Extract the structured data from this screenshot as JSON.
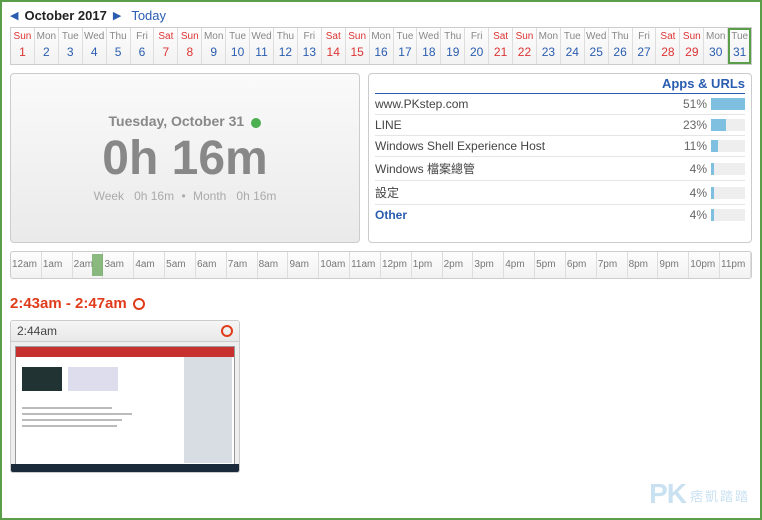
{
  "nav": {
    "prev_glyph": "◀",
    "next_glyph": "▶",
    "month_label": "October 2017",
    "today_label": "Today"
  },
  "calendar": {
    "selected_index": 30,
    "cells": [
      {
        "dow": "Sun",
        "n": "1",
        "wk": true
      },
      {
        "dow": "Mon",
        "n": "2",
        "wk": false
      },
      {
        "dow": "Tue",
        "n": "3",
        "wk": false
      },
      {
        "dow": "Wed",
        "n": "4",
        "wk": false
      },
      {
        "dow": "Thu",
        "n": "5",
        "wk": false
      },
      {
        "dow": "Fri",
        "n": "6",
        "wk": false
      },
      {
        "dow": "Sat",
        "n": "7",
        "wk": true
      },
      {
        "dow": "Sun",
        "n": "8",
        "wk": true
      },
      {
        "dow": "Mon",
        "n": "9",
        "wk": false
      },
      {
        "dow": "Tue",
        "n": "10",
        "wk": false
      },
      {
        "dow": "Wed",
        "n": "11",
        "wk": false
      },
      {
        "dow": "Thu",
        "n": "12",
        "wk": false
      },
      {
        "dow": "Fri",
        "n": "13",
        "wk": false
      },
      {
        "dow": "Sat",
        "n": "14",
        "wk": true
      },
      {
        "dow": "Sun",
        "n": "15",
        "wk": true
      },
      {
        "dow": "Mon",
        "n": "16",
        "wk": false
      },
      {
        "dow": "Tue",
        "n": "17",
        "wk": false
      },
      {
        "dow": "Wed",
        "n": "18",
        "wk": false
      },
      {
        "dow": "Thu",
        "n": "19",
        "wk": false
      },
      {
        "dow": "Fri",
        "n": "20",
        "wk": false
      },
      {
        "dow": "Sat",
        "n": "21",
        "wk": true
      },
      {
        "dow": "Sun",
        "n": "22",
        "wk": true
      },
      {
        "dow": "Mon",
        "n": "23",
        "wk": false
      },
      {
        "dow": "Tue",
        "n": "24",
        "wk": false
      },
      {
        "dow": "Wed",
        "n": "25",
        "wk": false
      },
      {
        "dow": "Thu",
        "n": "26",
        "wk": false
      },
      {
        "dow": "Fri",
        "n": "27",
        "wk": false
      },
      {
        "dow": "Sat",
        "n": "28",
        "wk": true
      },
      {
        "dow": "Sun",
        "n": "29",
        "wk": true
      },
      {
        "dow": "Mon",
        "n": "30",
        "wk": false
      },
      {
        "dow": "Tue",
        "n": "31",
        "wk": false
      }
    ]
  },
  "summary": {
    "date_label": "Tuesday, October 31",
    "big_time": "0h 16m",
    "week_label": "Week",
    "week_time": "0h 16m",
    "month_label": "Month",
    "month_time": "0h 16m"
  },
  "apps": {
    "header": "Apps & URLs",
    "rows": [
      {
        "name": "www.PKstep.com",
        "pct": "51%",
        "w": 51
      },
      {
        "name": "LINE",
        "pct": "23%",
        "w": 23
      },
      {
        "name": "Windows Shell Experience Host",
        "pct": "11%",
        "w": 11
      },
      {
        "name": "Windows 檔案總管",
        "pct": "4%",
        "w": 4
      },
      {
        "name": "設定",
        "pct": "4%",
        "w": 4
      }
    ],
    "other": {
      "name": "Other",
      "pct": "4%",
      "w": 4
    }
  },
  "timeline": {
    "hours": [
      "12am",
      "1am",
      "2am",
      "3am",
      "4am",
      "5am",
      "6am",
      "7am",
      "8am",
      "9am",
      "10am",
      "11am",
      "12pm",
      "1pm",
      "2pm",
      "3pm",
      "4pm",
      "5pm",
      "6pm",
      "7pm",
      "8pm",
      "9pm",
      "10pm",
      "11pm"
    ],
    "activity": [
      {
        "left_pct": 11.0,
        "width_pct": 1.4
      }
    ]
  },
  "range": {
    "text": "2:43am - 2:47am"
  },
  "shot": {
    "time": "2:44am"
  },
  "watermark": {
    "big": "PK",
    "small": "痞凱踏踏"
  }
}
